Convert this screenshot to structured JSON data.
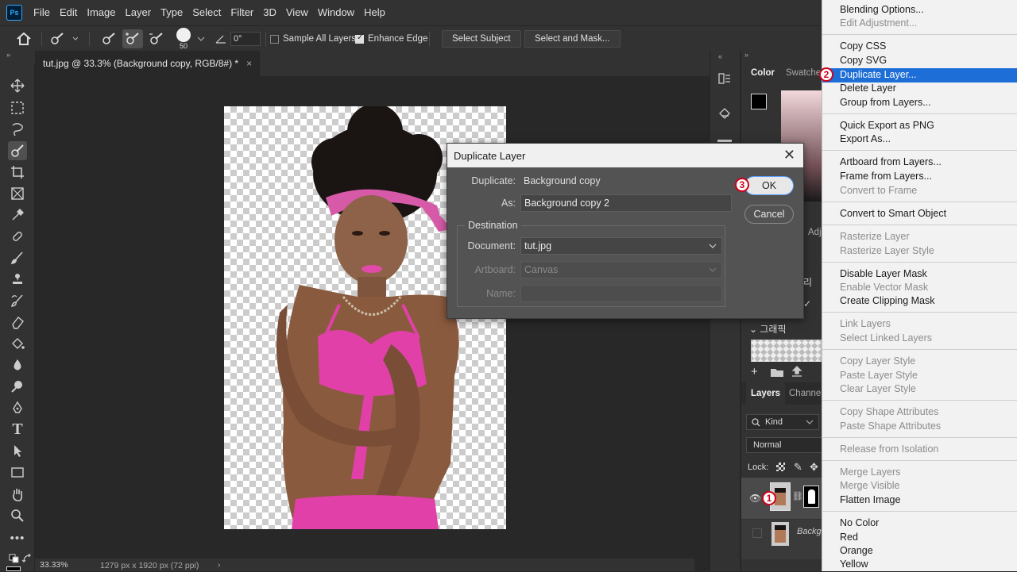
{
  "app": {
    "logo": "Ps"
  },
  "menu": [
    "File",
    "Edit",
    "Image",
    "Layer",
    "Type",
    "Select",
    "Filter",
    "3D",
    "View",
    "Window",
    "Help"
  ],
  "options_bar": {
    "brush_size": "50",
    "angle": "0°",
    "sample_all_layers": "Sample All Layers",
    "enhance_edge": "Enhance Edge",
    "select_subject": "Select Subject",
    "select_and_mask": "Select and Mask..."
  },
  "document_tab": {
    "title": "tut.jpg @ 33.3% (Background copy, RGB/8#) *",
    "close": "×"
  },
  "status_bar": {
    "zoom": "33.33%",
    "info": "1279 px x 1920 px (72 ppi)"
  },
  "panels": {
    "color_tab": "Color",
    "swatches_tab": "Swatche",
    "adjustments_tab": "Adj",
    "korean_label": "리",
    "graphic_label": "그래픽",
    "layers_tab": "Layers",
    "channels_tab": "Channel",
    "kind": "Kind",
    "blend_mode": "Normal",
    "lock_label": "Lock:",
    "layer_background": "Backg"
  },
  "dialog": {
    "title": "Duplicate Layer",
    "duplicate_label": "Duplicate:",
    "duplicate_value": "Background copy",
    "as_label": "As:",
    "as_value": "Background copy 2",
    "destination_label": "Destination",
    "document_label": "Document:",
    "document_value": "tut.jpg",
    "artboard_label": "Artboard:",
    "artboard_value": "Canvas",
    "name_label": "Name:",
    "ok": "OK",
    "cancel": "Cancel"
  },
  "context_menu": [
    {
      "label": "Blending Options...",
      "disabled": false
    },
    {
      "label": "Edit Adjustment...",
      "disabled": true
    },
    {
      "label": "Copy CSS",
      "disabled": false
    },
    {
      "label": "Copy SVG",
      "disabled": false
    },
    {
      "label": "Duplicate Layer...",
      "disabled": false,
      "highlighted": true
    },
    {
      "label": "Delete Layer",
      "disabled": false
    },
    {
      "label": "Group from Layers...",
      "disabled": false
    },
    {
      "label": "Quick Export as PNG",
      "disabled": false
    },
    {
      "label": "Export As...",
      "disabled": false
    },
    {
      "label": "Artboard from Layers...",
      "disabled": false
    },
    {
      "label": "Frame from Layers...",
      "disabled": false
    },
    {
      "label": "Convert to Frame",
      "disabled": true
    },
    {
      "label": "Convert to Smart Object",
      "disabled": false
    },
    {
      "label": "Rasterize Layer",
      "disabled": true
    },
    {
      "label": "Rasterize Layer Style",
      "disabled": true
    },
    {
      "label": "Disable Layer Mask",
      "disabled": false
    },
    {
      "label": "Enable Vector Mask",
      "disabled": true
    },
    {
      "label": "Create Clipping Mask",
      "disabled": false
    },
    {
      "label": "Link Layers",
      "disabled": true
    },
    {
      "label": "Select Linked Layers",
      "disabled": true
    },
    {
      "label": "Copy Layer Style",
      "disabled": true
    },
    {
      "label": "Paste Layer Style",
      "disabled": true
    },
    {
      "label": "Clear Layer Style",
      "disabled": true
    },
    {
      "label": "Copy Shape Attributes",
      "disabled": true
    },
    {
      "label": "Paste Shape Attributes",
      "disabled": true
    },
    {
      "label": "Release from Isolation",
      "disabled": true
    },
    {
      "label": "Merge Layers",
      "disabled": true
    },
    {
      "label": "Merge Visible",
      "disabled": true
    },
    {
      "label": "Flatten Image",
      "disabled": false
    },
    {
      "label": "No Color",
      "disabled": false
    },
    {
      "label": "Red",
      "disabled": false
    },
    {
      "label": "Orange",
      "disabled": false
    },
    {
      "label": "Yellow",
      "disabled": false
    }
  ],
  "steps": {
    "one": "1",
    "two": "2",
    "three": "3"
  },
  "colors": {
    "accent": "#1e6ed7",
    "step_marker": "#d0021b",
    "pink": "#e040a8"
  }
}
